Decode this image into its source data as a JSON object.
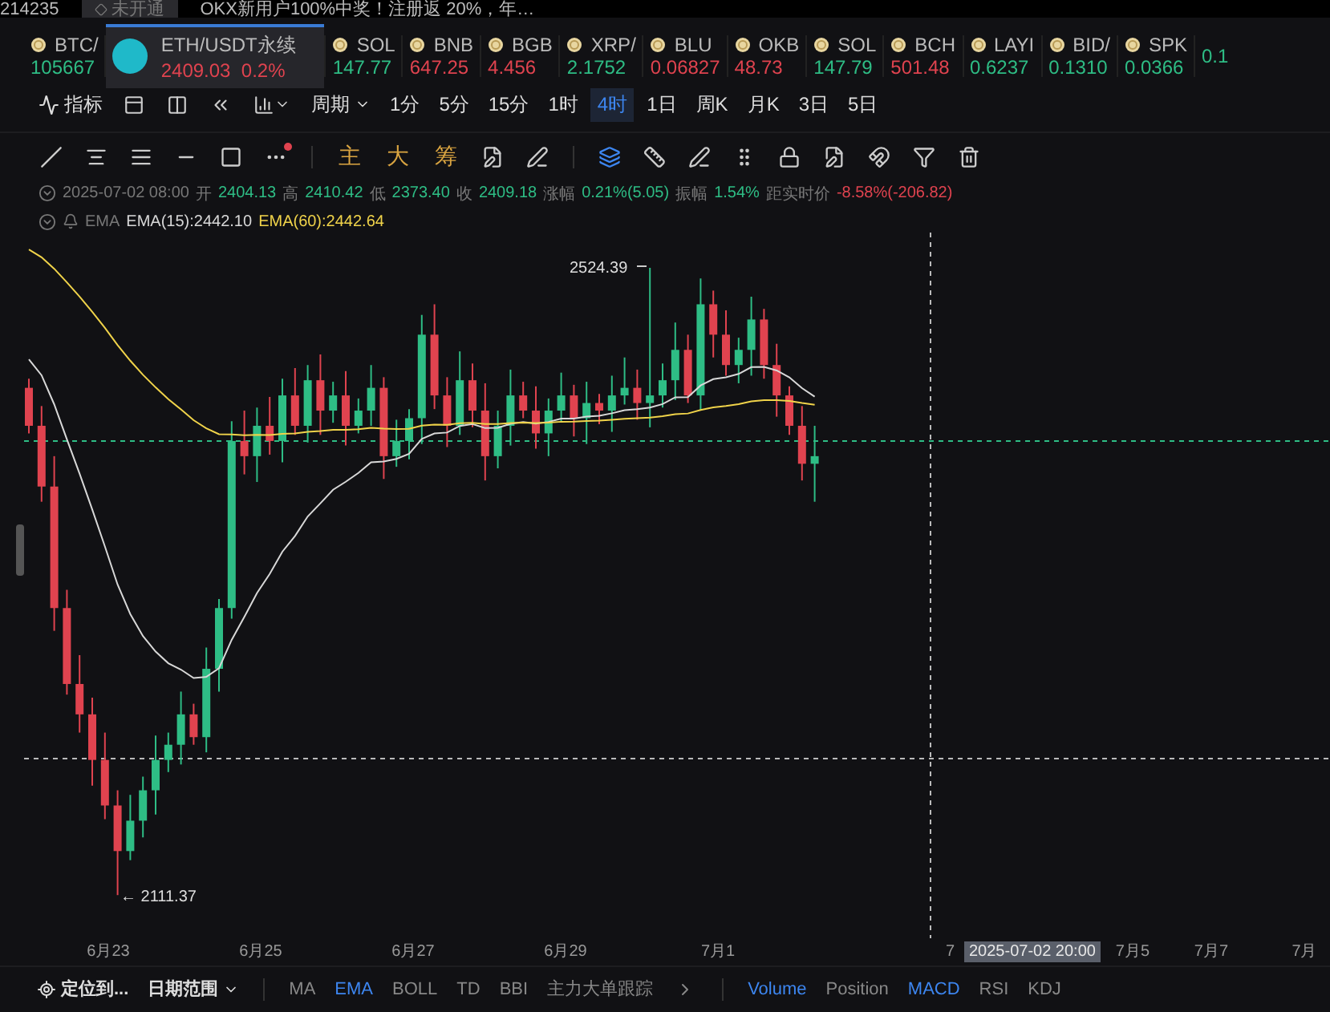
{
  "top_strip": {
    "ticker_value": "214235",
    "badge": "未开通",
    "notice": "OKX新用户100%中奖！注册返 20%，年…"
  },
  "tickers": [
    {
      "symbol": "BTC/",
      "price": "105667",
      "color": "#2ebd85",
      "selected": false
    },
    {
      "symbol": "ETH/USDT永续",
      "price": "2409.03",
      "change": "0.2%",
      "color": "#e0434f",
      "selected": true
    },
    {
      "symbol": "SOL",
      "price": "147.77",
      "color": "#2ebd85",
      "selected": false
    },
    {
      "symbol": "BNB",
      "price": "647.25",
      "color": "#e0434f",
      "selected": false
    },
    {
      "symbol": "BGB",
      "price": "4.456",
      "color": "#e0434f",
      "selected": false
    },
    {
      "symbol": "XRP/",
      "price": "2.1752",
      "color": "#2ebd85",
      "selected": false
    },
    {
      "symbol": "BLU",
      "price": "0.06827",
      "color": "#e0434f",
      "selected": false
    },
    {
      "symbol": "OKB",
      "price": "48.73",
      "color": "#e0434f",
      "selected": false
    },
    {
      "symbol": "SOL",
      "price": "147.79",
      "color": "#2ebd85",
      "selected": false
    },
    {
      "symbol": "BCH",
      "price": "501.48",
      "color": "#e0434f",
      "selected": false
    },
    {
      "symbol": "LAYI",
      "price": "0.6237",
      "color": "#2ebd85",
      "selected": false
    },
    {
      "symbol": "BID/",
      "price": "0.1310",
      "color": "#2ebd85",
      "selected": false
    },
    {
      "symbol": "SPK",
      "price": "0.0366",
      "color": "#2ebd85",
      "selected": false
    },
    {
      "price": "0.1",
      "color": "#2ebd85",
      "selected": false
    }
  ],
  "toolbar": {
    "indicator_button": "指标",
    "period_menu": "周期",
    "intervals": [
      {
        "label": "1分",
        "selected": false
      },
      {
        "label": "5分",
        "selected": false
      },
      {
        "label": "15分",
        "selected": false
      },
      {
        "label": "1时",
        "selected": false
      },
      {
        "label": "4时",
        "selected": true
      },
      {
        "label": "1日",
        "selected": false
      },
      {
        "label": "周K",
        "selected": false
      },
      {
        "label": "月K",
        "selected": false
      },
      {
        "label": "3日",
        "selected": false
      },
      {
        "label": "5日",
        "selected": false
      }
    ]
  },
  "drawing_tools": {
    "text_tools": [
      "主",
      "大",
      "筹"
    ]
  },
  "ohlc_info": {
    "time": "2025-07-02 08:00",
    "items": [
      {
        "label": "开",
        "value": "2404.13",
        "color": "#2ebd85"
      },
      {
        "label": "高",
        "value": "2410.42",
        "color": "#2ebd85"
      },
      {
        "label": "低",
        "value": "2373.40",
        "color": "#2ebd85"
      },
      {
        "label": "收",
        "value": "2409.18",
        "color": "#2ebd85"
      },
      {
        "label": "涨幅",
        "value": "0.21%(5.05)",
        "color": "#2ebd85"
      },
      {
        "label": "振幅",
        "value": "1.54%",
        "color": "#2ebd85"
      },
      {
        "label": "距实时价",
        "value": "-8.58%(-206.82)",
        "color": "#e0434f"
      }
    ]
  },
  "ema_info": {
    "label": "EMA",
    "lines": [
      {
        "text": "EMA(15):2442.10",
        "color": "#d8d8d8"
      },
      {
        "text": "EMA(60):2442.64",
        "color": "#f0d34a"
      }
    ]
  },
  "chart": {
    "high_label": "2524.39",
    "low_label": "← 2111.37",
    "crosshair_time": "2025-07-02 20:00",
    "x_labels": [
      "6月23",
      "6月25",
      "6月27",
      "6月29",
      "7月1",
      "7"
    ],
    "x_labels_after": [
      "7月5",
      "7月7",
      "7月"
    ]
  },
  "bottom_bar": {
    "locate_button": "定位到...",
    "date_range": "日期范围",
    "main_indicators": [
      {
        "label": "MA",
        "selected": false
      },
      {
        "label": "EMA",
        "selected": true
      },
      {
        "label": "BOLL",
        "selected": false
      },
      {
        "label": "TD",
        "selected": false
      },
      {
        "label": "BBI",
        "selected": false
      },
      {
        "label": "主力大单跟踪",
        "selected": false
      }
    ],
    "sub_indicators": [
      {
        "label": "Volume",
        "selected": true
      },
      {
        "label": "Position",
        "selected": false
      },
      {
        "label": "MACD",
        "selected": true
      },
      {
        "label": "RSI",
        "selected": false
      },
      {
        "label": "KDJ",
        "selected": false
      }
    ]
  }
}
